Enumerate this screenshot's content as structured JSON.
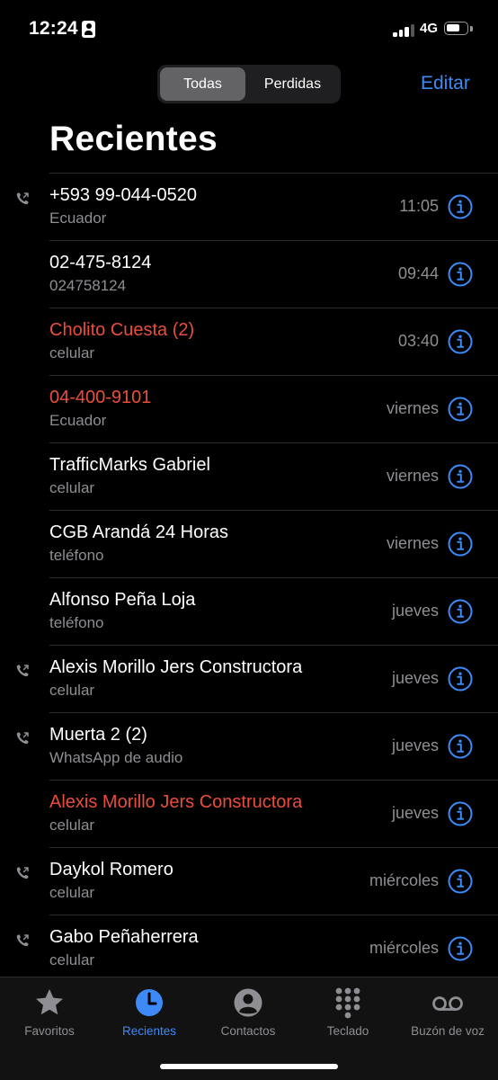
{
  "status_bar": {
    "time": "12:24",
    "network": "4G",
    "signal_bars_filled": 3,
    "signal_bars_total": 4,
    "battery_level": 0.7
  },
  "header": {
    "segments": [
      "Todas",
      "Perdidas"
    ],
    "selected_segment": "Todas",
    "edit_label": "Editar",
    "title": "Recientes"
  },
  "colors": {
    "accent": "#3d8af7",
    "missed": "#eb4d3d",
    "secondary_text": "#8e8e93"
  },
  "calls": [
    {
      "name": "+593 99-044-0520",
      "sub": "Ecuador",
      "time": "11:05",
      "missed": false,
      "outgoing": true
    },
    {
      "name": "02-475-8124",
      "sub": "024758124",
      "time": "09:44",
      "missed": false,
      "outgoing": false
    },
    {
      "name": "Cholito Cuesta (2)",
      "sub": "celular",
      "time": "03:40",
      "missed": true,
      "outgoing": false
    },
    {
      "name": "04-400-9101",
      "sub": "Ecuador",
      "time": "viernes",
      "missed": true,
      "outgoing": false
    },
    {
      "name": "TrafficMarks Gabriel",
      "sub": "celular",
      "time": "viernes",
      "missed": false,
      "outgoing": false
    },
    {
      "name": "CGB Arandá  24 Horas",
      "sub": "teléfono",
      "time": "viernes",
      "missed": false,
      "outgoing": false
    },
    {
      "name": "Alfonso Peña Loja",
      "sub": "teléfono",
      "time": "jueves",
      "missed": false,
      "outgoing": false
    },
    {
      "name": "Alexis Morillo Jers Constructora",
      "sub": "celular",
      "time": "jueves",
      "missed": false,
      "outgoing": true
    },
    {
      "name": "Muerta 2 (2)",
      "sub": "WhatsApp de audio",
      "time": "jueves",
      "missed": false,
      "outgoing": true
    },
    {
      "name": "Alexis Morillo Jers Constructora",
      "sub": "celular",
      "time": "jueves",
      "missed": true,
      "outgoing": false
    },
    {
      "name": "Daykol Romero",
      "sub": "celular",
      "time": "miércoles",
      "missed": false,
      "outgoing": true
    },
    {
      "name": "Gabo Peñaherrera",
      "sub": "celular",
      "time": "miércoles",
      "missed": false,
      "outgoing": true
    }
  ],
  "tab_bar": {
    "items": [
      {
        "label": "Favoritos",
        "icon": "star-icon"
      },
      {
        "label": "Recientes",
        "icon": "clock-icon"
      },
      {
        "label": "Contactos",
        "icon": "person-icon"
      },
      {
        "label": "Teclado",
        "icon": "keypad-icon"
      },
      {
        "label": "Buzón de voz",
        "icon": "voicemail-icon"
      }
    ],
    "selected": "Recientes"
  }
}
